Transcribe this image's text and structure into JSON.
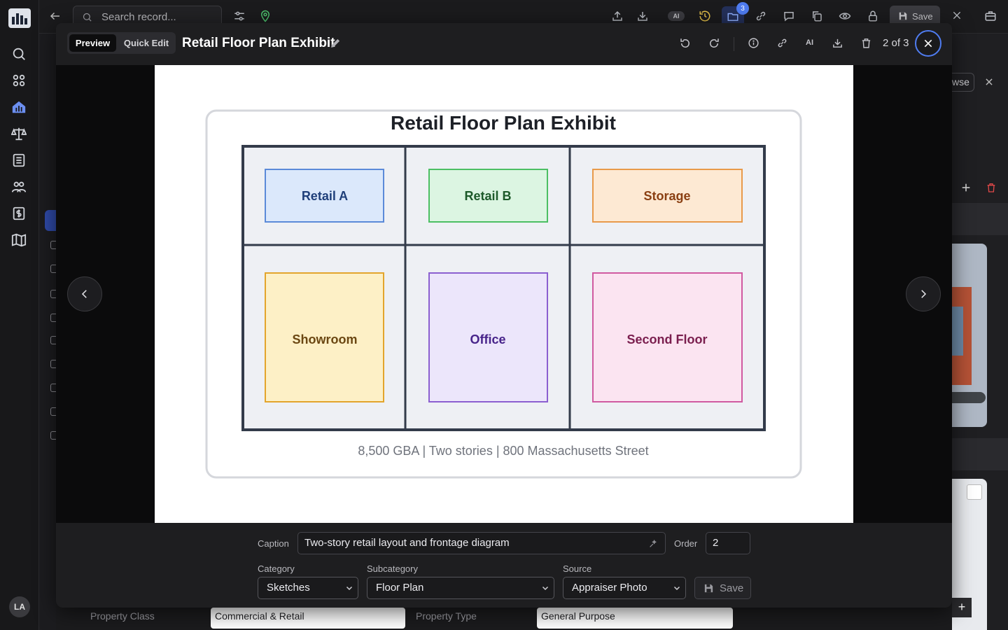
{
  "app": {
    "user_initials": "LA"
  },
  "topbar": {
    "search_placeholder": "Search record...",
    "ai_label": "AI",
    "folder_count": "3",
    "save_label": "Save"
  },
  "background": {
    "browse_fragment": "wse",
    "property_class_label": "Property Class",
    "property_class_value": "Commercial & Retail",
    "property_type_label": "Property Type",
    "property_type_value": "General Purpose"
  },
  "modal": {
    "tabs": [
      {
        "label": "Preview",
        "active": true
      },
      {
        "label": "Quick Edit",
        "active": false
      }
    ],
    "title": "Retail Floor Plan Exhibit",
    "ai_label": "AI",
    "counter": "2 of 3"
  },
  "exhibit": {
    "title": "Retail Floor Plan Exhibit",
    "rooms": [
      {
        "label": "Retail A",
        "fill": "#dbe8fb",
        "stroke": "#5b8ad8",
        "text": "#1f3f7a"
      },
      {
        "label": "Retail B",
        "fill": "#dcf5e2",
        "stroke": "#4cbf63",
        "text": "#1d5a2a"
      },
      {
        "label": "Storage",
        "fill": "#fde9d3",
        "stroke": "#e89a4a",
        "text": "#8a3f12"
      },
      {
        "label": "Showroom",
        "fill": "#fdf0c6",
        "stroke": "#e3a52c",
        "text": "#6b4712"
      },
      {
        "label": "Office",
        "fill": "#ece6fb",
        "stroke": "#8b5fd0",
        "text": "#47238a"
      },
      {
        "label": "Second Floor",
        "fill": "#fbe4f1",
        "stroke": "#d05aa0",
        "text": "#7a1e4e"
      }
    ],
    "footer": "8,500 GBA | Two stories | 800 Massachusetts Street"
  },
  "form": {
    "caption_label": "Caption",
    "caption_value": "Two-story retail layout and frontage diagram",
    "order_label": "Order",
    "order_value": "2",
    "category_label": "Category",
    "category_value": "Sketches",
    "subcategory_label": "Subcategory",
    "subcategory_value": "Floor Plan",
    "source_label": "Source",
    "source_value": "Appraiser Photo",
    "save_label": "Save"
  },
  "colors": {
    "accent": "#4f7cf0",
    "danger": "#e04848"
  }
}
